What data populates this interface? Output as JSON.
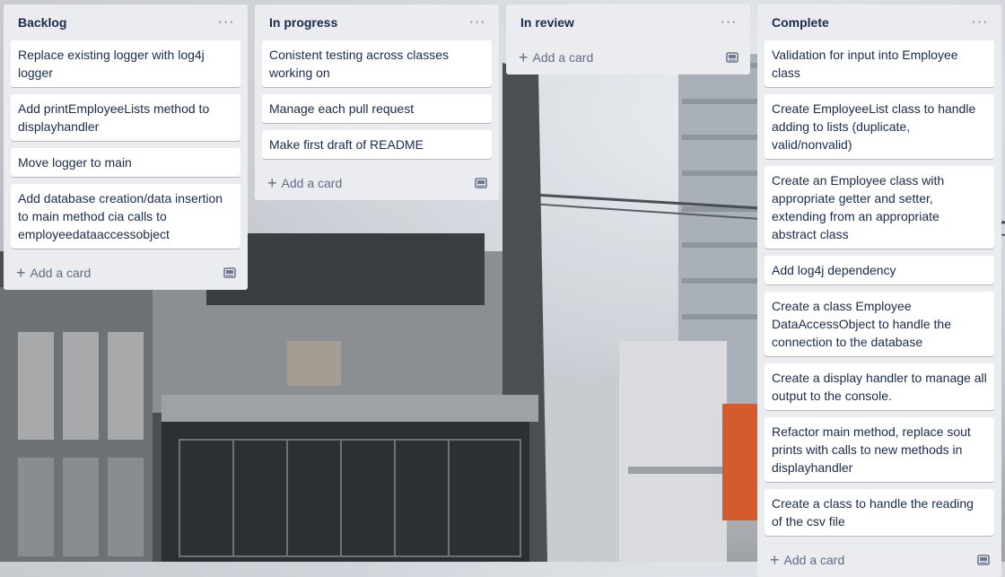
{
  "lists": [
    {
      "title": "Backlog",
      "cards": [
        "Replace existing logger with log4j logger",
        "Add printEmployeeLists method to displayhandler",
        "Move logger to main",
        "Add database creation/data insertion to main method cia calls to employeedataaccessobject"
      ],
      "add_label": "Add a card"
    },
    {
      "title": "In progress",
      "cards": [
        "Conistent testing across classes working on",
        "Manage each pull request",
        "Make first draft of README"
      ],
      "add_label": "Add a card"
    },
    {
      "title": "In review",
      "cards": [],
      "add_label": "Add a card"
    },
    {
      "title": "Complete",
      "cards": [
        "Validation for input into Employee class",
        "Create EmployeeList class to handle adding to lists (duplicate, valid/nonvalid)",
        "Create an Employee class with appropriate getter and setter, extending from an appropriate abstract class",
        "Add log4j dependency",
        "Create a class Employee DataAccessObject to handle the connection to the database",
        "Create a display handler to manage all output to the console.",
        "Refactor main method, replace sout prints with calls to new methods in displayhandler",
        "Create a class to handle the reading of the csv file"
      ],
      "add_label": "Add a card"
    }
  ],
  "icons": {
    "list_menu": "ellipsis-icon",
    "add": "plus-icon",
    "template": "card-template-icon"
  },
  "colors": {
    "list_bg": "#ebecf0",
    "card_bg": "#ffffff",
    "text": "#172b4d",
    "muted": "#5e6c84"
  }
}
